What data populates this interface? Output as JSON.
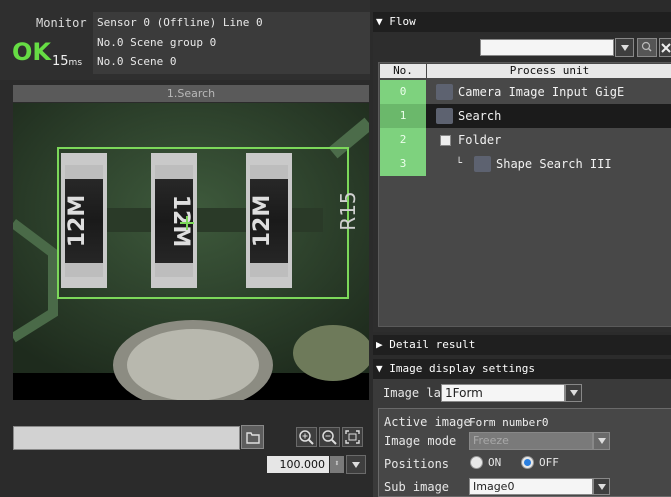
{
  "monitor": {
    "label": "Monitor",
    "status": "OK",
    "time_value": "15",
    "time_unit": "ms",
    "lines": [
      "Sensor 0 (Offline) Line 0",
      "No.0 Scene group 0",
      "No.0 Scene 0"
    ]
  },
  "image": {
    "title": "1.Search",
    "part_markings": [
      "12M",
      "12M",
      "12M"
    ],
    "board_marking": "R15"
  },
  "zoom": {
    "value": "100.000"
  },
  "flow": {
    "title": "▼ Flow",
    "columns": {
      "no": "No.",
      "unit": "Process unit"
    },
    "rows": [
      {
        "no": "0",
        "label": "Camera Image Input GigE",
        "icon": "camera-icon"
      },
      {
        "no": "1",
        "label": "Search",
        "icon": "search-unit-icon"
      },
      {
        "no": "2",
        "label": "Folder",
        "icon": "folder-collapse-icon"
      },
      {
        "no": "3",
        "label": "Shape Search III",
        "icon": "shape-search-icon",
        "prefix": "└"
      }
    ]
  },
  "detail": {
    "title": "▶ Detail result"
  },
  "display": {
    "title": "▼ Image display settings",
    "layout_label": "Image layout",
    "layout_value": "1Form",
    "active_image_label": "Active image",
    "active_image_value": "Form number0",
    "mode_label": "Image mode",
    "mode_value": "Freeze",
    "positions_label": "Positions",
    "on_label": "ON",
    "off_label": "OFF",
    "positions_selected": "OFF",
    "sub_image_label": "Sub image",
    "sub_image_value": "Image0"
  },
  "colors": {
    "ok": "#66dd44",
    "flow_no": "#7ed27e",
    "detect_box": "#7cd85a",
    "crosshair": "#7cd85a"
  }
}
